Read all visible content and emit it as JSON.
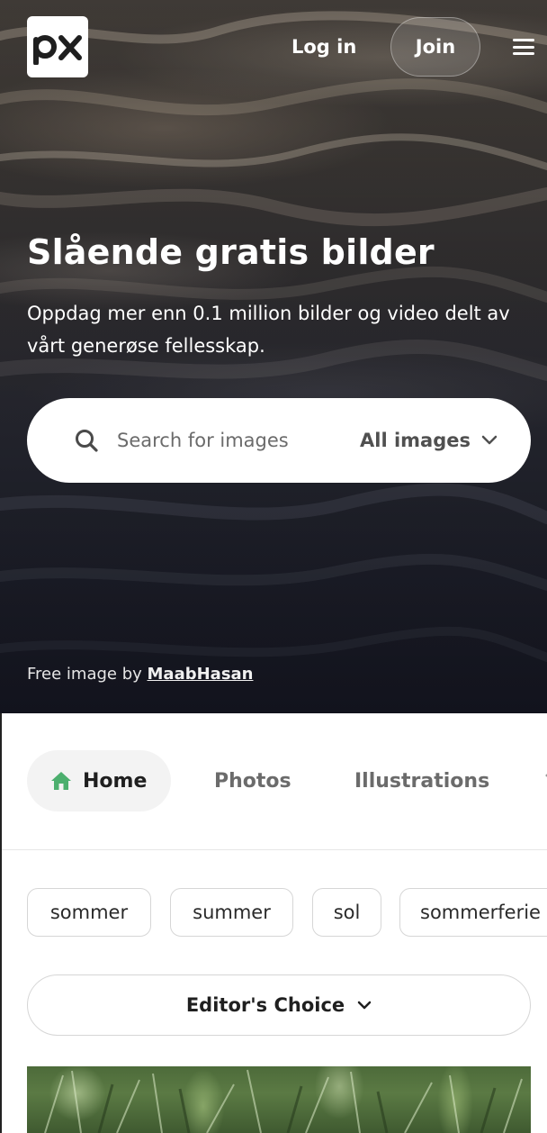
{
  "header": {
    "logo_text": "px",
    "login_label": "Log in",
    "join_label": "Join"
  },
  "hero": {
    "title": "Slående gratis bilder",
    "subtitle": "Oppdag mer enn 0.1 million bilder og video delt av vårt generøse fellesskap.",
    "search": {
      "placeholder": "Search for images",
      "type_value": "All images"
    },
    "credit_prefix": "Free image by ",
    "credit_author": "MaabHasan"
  },
  "tabs": [
    {
      "label": "Home",
      "active": true,
      "icon": "home-icon"
    },
    {
      "label": "Photos",
      "active": false
    },
    {
      "label": "Illustrations",
      "active": false
    }
  ],
  "tags": [
    "sommer",
    "summer",
    "sol",
    "sommerferie"
  ],
  "filter": {
    "label": "Editor's Choice"
  },
  "colors": {
    "accent_green": "#4caf6e",
    "text_dark": "#1f1f1f",
    "text_muted": "#6b6b6b"
  }
}
